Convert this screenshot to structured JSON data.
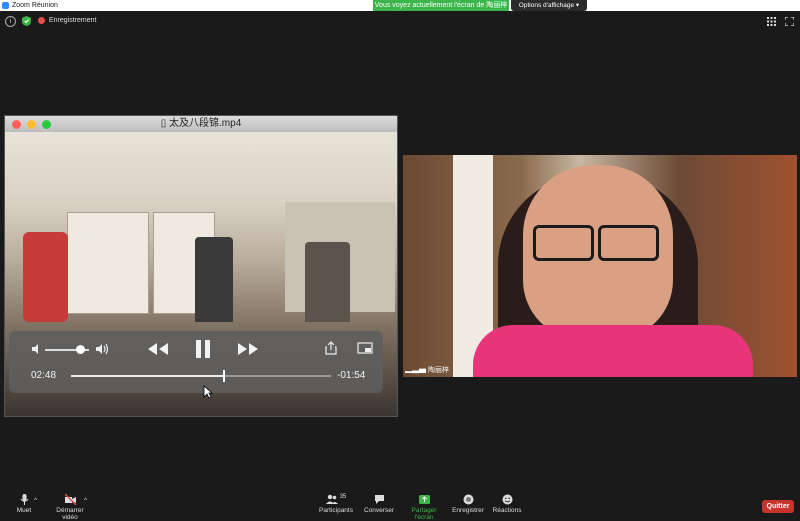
{
  "app": {
    "title": "Zoom Réunion"
  },
  "banner": {
    "sharing_text": "Vous voyez actuellement l'écran de 陶丽梓",
    "view_options": "Options d'affichage"
  },
  "meeting": {
    "recording_label": "Enregistrement"
  },
  "player": {
    "filename": "太及八段锦.mp4",
    "elapsed": "02:48",
    "remaining": "-01:54",
    "progress": 0.59,
    "volume": 0.8
  },
  "camera": {
    "participant_name": "陶丽梓"
  },
  "toolbar": {
    "mute": "Muet",
    "video": "Démarrer vidéo",
    "participants": "Participants",
    "participants_count": "35",
    "chat": "Converser",
    "share": "Partager l'écran",
    "record": "Enregistrer",
    "reactions": "Réactions",
    "leave": "Quitter"
  },
  "colors": {
    "share_green": "#3cb54a",
    "leave_red": "#c8332c",
    "zoom_blue": "#2d8cff"
  }
}
